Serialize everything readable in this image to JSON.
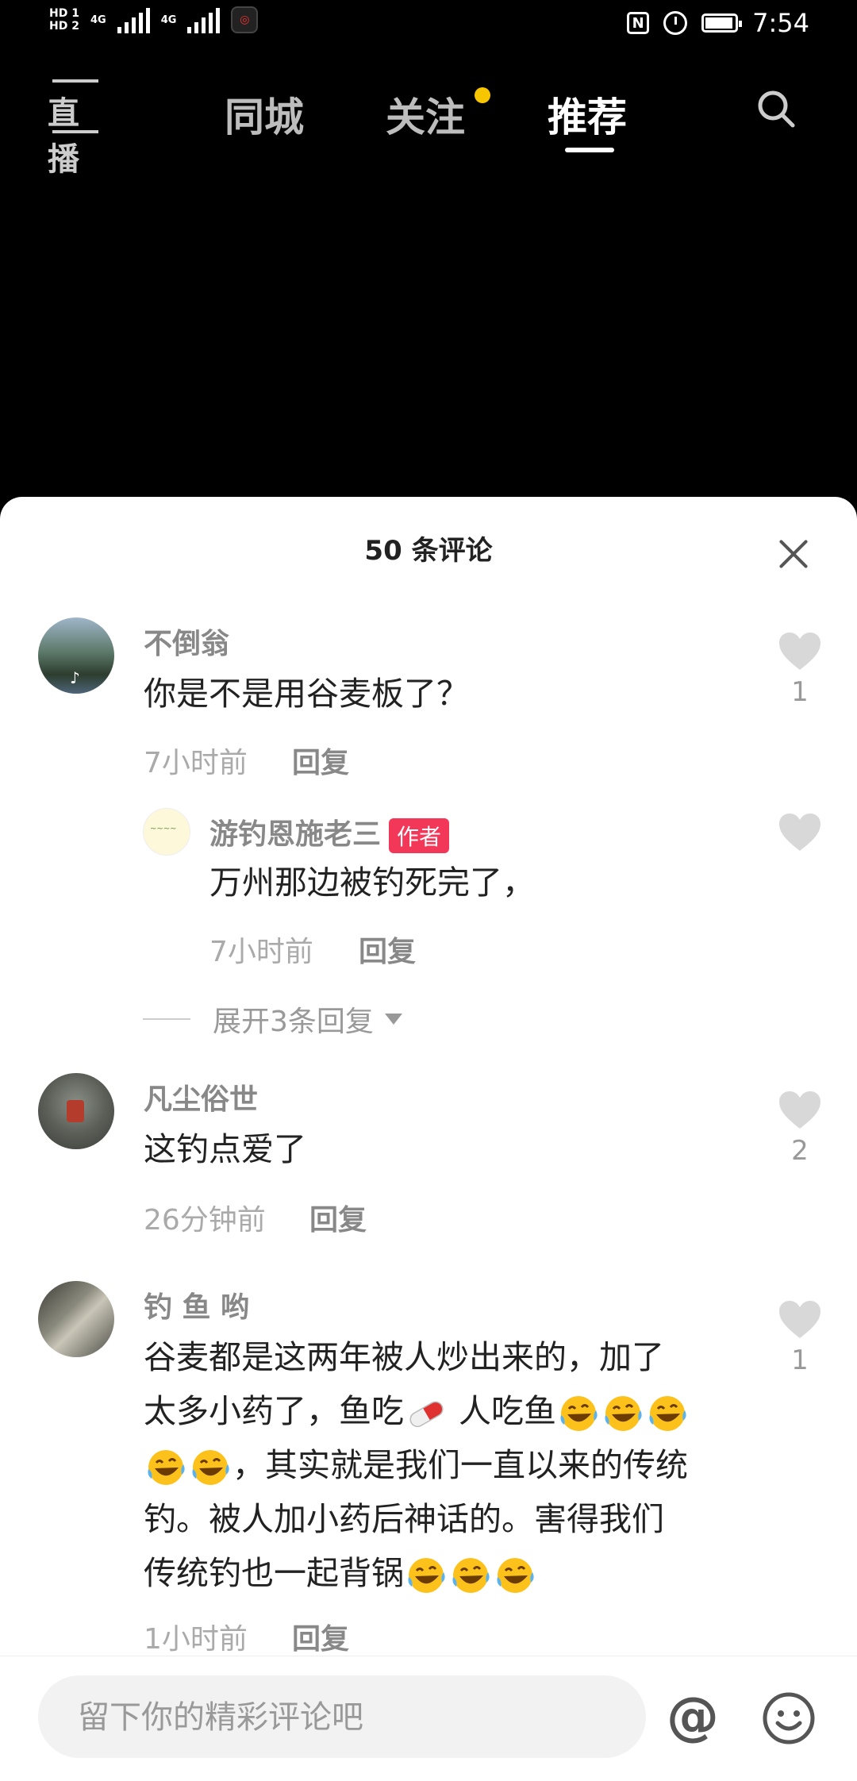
{
  "status_bar": {
    "sim1_label": "HD",
    "sim1_index": "1",
    "sim2_label": "HD",
    "sim2_index": "2",
    "network_1": "4G",
    "network_2": "4G",
    "nfc_label": "N",
    "time": "7:54"
  },
  "top_nav": {
    "live_label": "直播",
    "tabs": [
      {
        "label": "同城",
        "active": false
      },
      {
        "label": "关注",
        "active": false,
        "has_dot": true
      },
      {
        "label": "推荐",
        "active": true
      }
    ],
    "dot_color": "#f7c600"
  },
  "comments_sheet": {
    "title": "50 条评论",
    "comments": [
      {
        "user": "不倒翁",
        "text": "你是不是用谷麦板了？",
        "time": "7小时前",
        "reply_label": "回复",
        "likes": "1",
        "replies": [
          {
            "user": "游钓恩施老三",
            "badge": "作者",
            "text": "万州那边被钓死完了，",
            "time": "7小时前",
            "reply_label": "回复"
          }
        ],
        "expand_label": "展开3条回复"
      },
      {
        "user": "凡尘俗世",
        "text": "这钓点爱了",
        "time": "26分钟前",
        "reply_label": "回复",
        "likes": "2"
      },
      {
        "user": "钓 鱼  哟",
        "text_line1": "谷麦都是这两年被人炒出来的，加了",
        "text_line2a": "太多小药了，鱼吃",
        "text_line2b": " 人吃鱼",
        "text_line3": "，其实就是我们一直以来的传统",
        "text_line4": "钓。被人加小药后神话的。害得我们",
        "text_line5": "传统钓也一起背锅",
        "time": "1小时前",
        "reply_label": "回复",
        "likes": "1"
      }
    ]
  },
  "input_bar": {
    "placeholder": "留下你的精彩评论吧",
    "at_label": "@"
  },
  "colors": {
    "author_badge": "#f33758",
    "like_heart": "#d8d8d8"
  },
  "icons": [
    "search-icon",
    "close-icon",
    "heart-icon",
    "pill-emoji",
    "laugh-cry-emoji",
    "at-icon",
    "smile-icon"
  ]
}
